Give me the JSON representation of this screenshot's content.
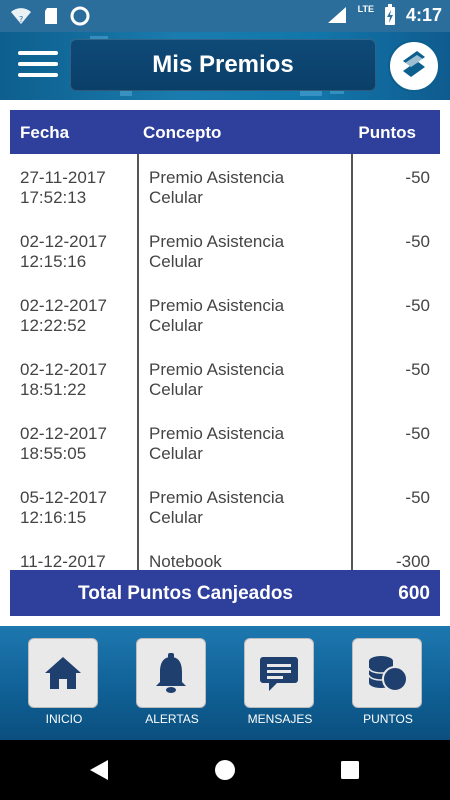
{
  "status_bar": {
    "clock": "4:17",
    "network": "LTE",
    "colors": {
      "bg": "#2b6e9c"
    }
  },
  "header": {
    "title": "Mis Premios",
    "menu_icon": "hamburger-menu-icon",
    "logo_icon": "brand-logo-icon"
  },
  "table": {
    "columns": [
      "Fecha",
      "Concepto",
      "Puntos"
    ],
    "rows": [
      {
        "date": "27-11-2017",
        "time": "17:52:13",
        "concept_line1": "Premio Asistencia",
        "concept_line2": "Celular",
        "points": "-50"
      },
      {
        "date": "02-12-2017",
        "time": "12:15:16",
        "concept_line1": "Premio Asistencia",
        "concept_line2": "Celular",
        "points": "-50"
      },
      {
        "date": "02-12-2017",
        "time": "12:22:52",
        "concept_line1": "Premio Asistencia",
        "concept_line2": "Celular",
        "points": "-50"
      },
      {
        "date": "02-12-2017",
        "time": "18:51:22",
        "concept_line1": "Premio Asistencia",
        "concept_line2": "Celular",
        "points": "-50"
      },
      {
        "date": "02-12-2017",
        "time": "18:55:05",
        "concept_line1": "Premio Asistencia",
        "concept_line2": "Celular",
        "points": "-50"
      },
      {
        "date": "05-12-2017",
        "time": "12:16:15",
        "concept_line1": "Premio Asistencia",
        "concept_line2": "Celular",
        "points": "-50"
      },
      {
        "date": "11-12-2017",
        "time": "",
        "concept_line1": "Notebook",
        "concept_line2": "",
        "points": "-300"
      }
    ],
    "footer": {
      "label": "Total Puntos Canjeados",
      "value": "600"
    },
    "colors": {
      "header_bg": "#2e3f9c"
    }
  },
  "bottom_nav": {
    "items": [
      {
        "label": "INICIO",
        "icon": "home-icon"
      },
      {
        "label": "ALERTAS",
        "icon": "bell-icon"
      },
      {
        "label": "MENSAJES",
        "icon": "message-icon"
      },
      {
        "label": "PUNTOS",
        "icon": "coins-icon"
      }
    ],
    "colors": {
      "icon": "#1f3f6e"
    }
  },
  "system_nav": {
    "buttons": [
      "back-icon",
      "home-circle-icon",
      "recents-icon"
    ]
  }
}
